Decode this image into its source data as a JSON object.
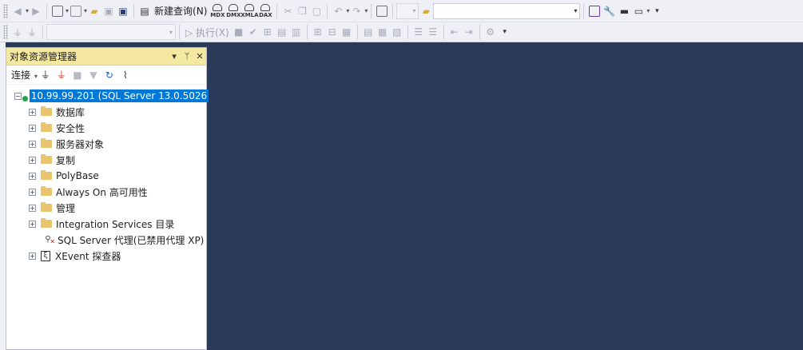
{
  "colors": {
    "workspace": "#2c3a5a",
    "toolbar": "#eef0f5",
    "panel_header": "#f5e9a2",
    "selection": "#0078d7",
    "folder": "#e8c46c"
  },
  "toolbar": {
    "new_query_label": "新建查询(N)",
    "execute_label": "执行(X)",
    "mini_labels": [
      "MDX",
      "DMX",
      "XMLA",
      "DAX"
    ]
  },
  "object_explorer": {
    "title": "对象资源管理器",
    "connect_label": "连接",
    "root": {
      "label": "10.99.99.201 (SQL Server 13.0.5026"
    },
    "items": [
      {
        "label": "数据库",
        "icon": "folder-icon"
      },
      {
        "label": "安全性",
        "icon": "folder-icon"
      },
      {
        "label": "服务器对象",
        "icon": "folder-icon"
      },
      {
        "label": "复制",
        "icon": "folder-icon"
      },
      {
        "label": "PolyBase",
        "icon": "folder-icon"
      },
      {
        "label": "Always On 高可用性",
        "icon": "folder-icon"
      },
      {
        "label": "管理",
        "icon": "folder-icon"
      },
      {
        "label": "Integration Services 目录",
        "icon": "folder-icon"
      },
      {
        "label": "SQL Server 代理(已禁用代理 XP)",
        "icon": "sql-agent-disabled-icon"
      },
      {
        "label": "XEvent 探查器",
        "icon": "xevent-profiler-icon"
      }
    ]
  }
}
